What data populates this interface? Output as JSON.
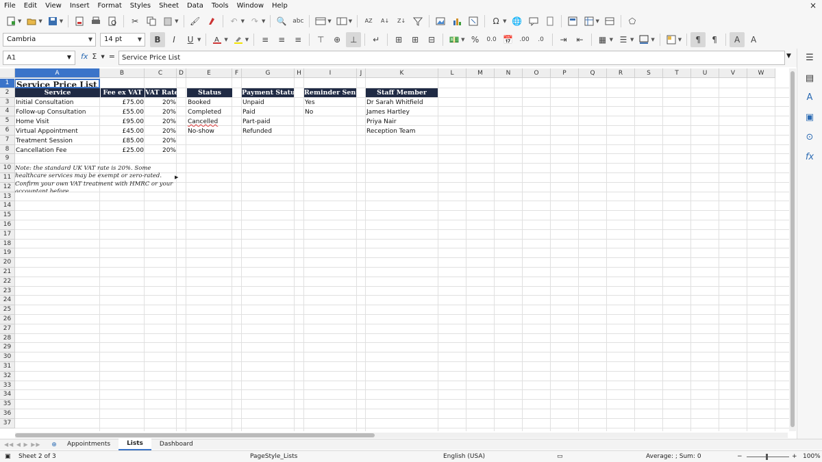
{
  "menu": [
    "File",
    "Edit",
    "View",
    "Insert",
    "Format",
    "Styles",
    "Sheet",
    "Data",
    "Tools",
    "Window",
    "Help"
  ],
  "window": {
    "close_glyph": "×"
  },
  "toolbar": {
    "font_name": "Cambria",
    "font_size": "14 pt",
    "bold_label": "B",
    "italic_label": "I",
    "underline_label": "U"
  },
  "formula_bar": {
    "cell_ref": "A1",
    "content": "Service Price List"
  },
  "columns": [
    "A",
    "B",
    "C",
    "D",
    "E",
    "F",
    "G",
    "H",
    "I",
    "J",
    "K",
    "L",
    "M",
    "N",
    "O",
    "P",
    "Q",
    "R",
    "S",
    "T",
    "U",
    "V",
    "W"
  ],
  "rows": [
    "1",
    "2",
    "3",
    "4",
    "5",
    "6",
    "7",
    "8",
    "9",
    "10",
    "11",
    "12",
    "13",
    "14",
    "15",
    "16",
    "17",
    "18",
    "19",
    "20",
    "21",
    "22",
    "23",
    "24",
    "25",
    "26",
    "27",
    "28",
    "29",
    "30",
    "31",
    "32",
    "33",
    "34",
    "35",
    "36",
    "37"
  ],
  "sheet": {
    "title": "Service Price List",
    "headers": {
      "service": "Service",
      "fee": "Fee ex VAT",
      "vat": "VAT Rate",
      "status": "Status",
      "payment": "Payment Status",
      "reminder": "Reminder Sent?",
      "staff": "Staff Member"
    },
    "services": [
      {
        "name": "Initial Consultation",
        "fee": "£75.00",
        "vat": "20%"
      },
      {
        "name": "Follow-up Consultation",
        "fee": "£55.00",
        "vat": "20%"
      },
      {
        "name": "Home Visit",
        "fee": "£95.00",
        "vat": "20%"
      },
      {
        "name": "Virtual Appointment",
        "fee": "£45.00",
        "vat": "20%"
      },
      {
        "name": "Treatment Session",
        "fee": "£85.00",
        "vat": "20%"
      },
      {
        "name": "Cancellation Fee",
        "fee": "£25.00",
        "vat": "20%"
      }
    ],
    "status_list": [
      "Booked",
      "Completed",
      "Cancelled",
      "No-show"
    ],
    "payment_list": [
      "Unpaid",
      "Paid",
      "Part-paid",
      "Refunded"
    ],
    "reminder_list": [
      "Yes",
      "No"
    ],
    "staff_list": [
      "Dr Sarah Whitfield",
      "James Hartley",
      "Priya Nair",
      "Reception Team"
    ],
    "note": "Note: the standard UK VAT rate is 20%. Some healthcare services may be exempt or zero-rated. Confirm your own VAT treatment with HMRC or your accountant before"
  },
  "tabs": [
    "Appointments",
    "Lists",
    "Dashboard"
  ],
  "status_bar": {
    "sheet": "Sheet 2 of 3",
    "page_style": "PageStyle_Lists",
    "language": "English (USA)",
    "summary": "Average: ; Sum: 0",
    "zoom": "100%"
  },
  "icons": {
    "new": "new-document-icon",
    "open": "open-folder-icon",
    "save": "save-icon",
    "function": "fx-icon",
    "sum": "sigma-icon"
  },
  "colors": {
    "header_fill": "#1f2a44",
    "selection": "#3b74c9",
    "accent": "#2a6ab3"
  }
}
